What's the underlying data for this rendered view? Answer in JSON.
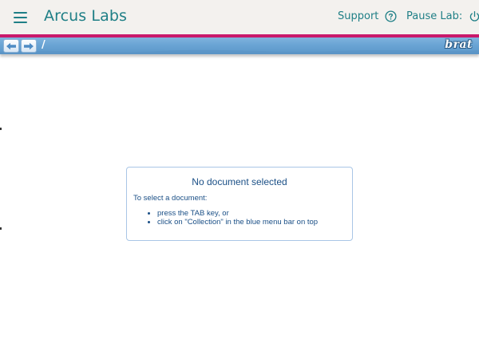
{
  "header": {
    "title": "Arcus Labs",
    "support_label": "Support",
    "pause_label": "Pause Lab:",
    "icons": {
      "menu": "hamburger-menu-icon",
      "support": "question-circle-icon",
      "pause": "power-icon"
    },
    "colors": {
      "text": "#1f7f86",
      "background": "#f3f1ee",
      "accent_line": "#c9196b"
    }
  },
  "brat_bar": {
    "path": "/",
    "logo": "brat",
    "icons": {
      "back": "arrow-left-icon",
      "forward": "arrow-right-icon"
    },
    "color": "#6aa4d4"
  },
  "message_box": {
    "title": "No document selected",
    "intro": "To select a document:",
    "items": [
      "press the TAB key, or",
      "click on \"Collection\" in the blue menu bar on top"
    ],
    "text_color": "#1a4f86"
  }
}
